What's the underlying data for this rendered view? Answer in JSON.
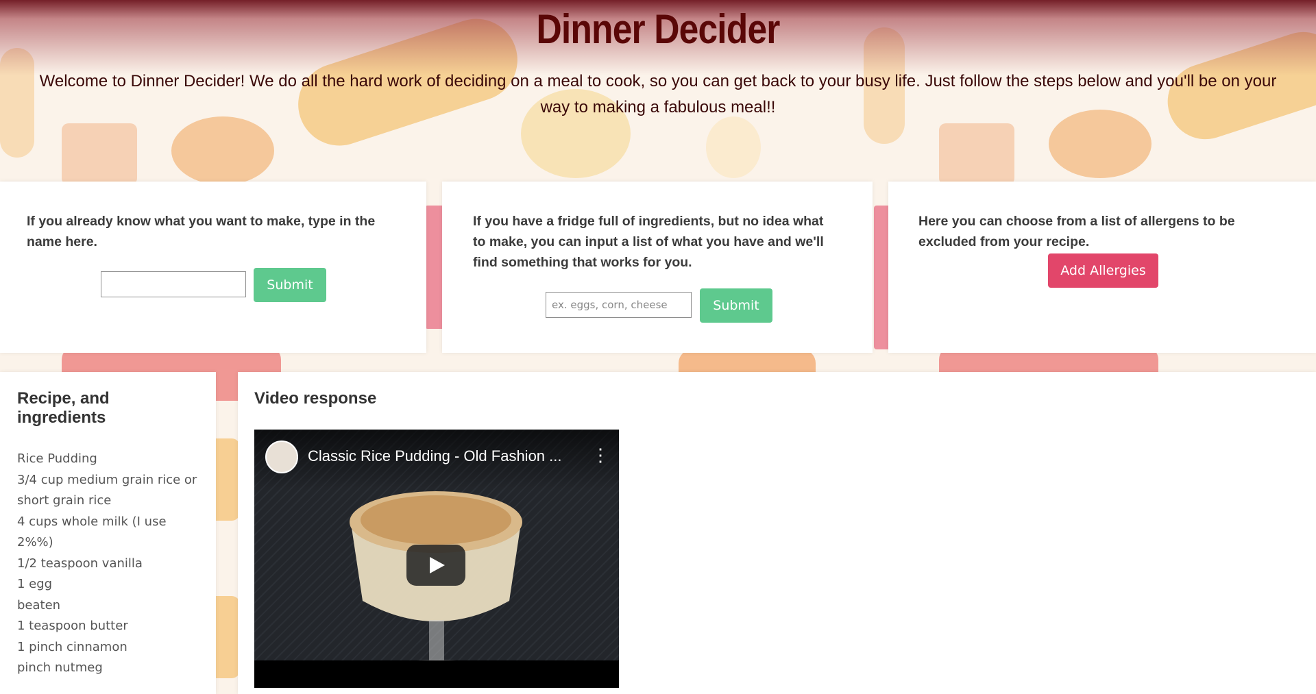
{
  "header": {
    "title": "Dinner Decider",
    "intro_line1": "Welcome to Dinner Decider! We do all the hard work of deciding on a meal to cook, so you can get back to your busy life. Just follow the steps below and you'll be on your",
    "intro_line2": "way to making a fabulous meal!!"
  },
  "card_name": {
    "text_line1": "If you already know what you want to make, type in the",
    "text_line2": "name here.",
    "input_value": "",
    "input_placeholder": "",
    "submit_label": "Submit"
  },
  "card_ingredients": {
    "text_line1": "If you have a fridge full of ingredients, but no idea what",
    "text_line2": "to make, you can input a list of what you have and we'll",
    "text_line3": "find something that works for you.",
    "input_value": "",
    "input_placeholder": "ex. eggs, corn, cheese",
    "submit_label": "Submit"
  },
  "card_allergens": {
    "text_line1": "Here you can choose from a list of allergens to be",
    "text_line2": "excluded from your recipe.",
    "button_label": "Add Allergies"
  },
  "recipe": {
    "title_line1": "Recipe, and",
    "title_line2": "ingredients",
    "lines": [
      "Rice Pudding",
      "3/4 cup medium grain rice or",
      "short grain rice",
      "4 cups whole milk (I use",
      "2%%)",
      "1/2 teaspoon vanilla",
      "1 egg",
      "beaten",
      "1 teaspoon butter",
      "1 pinch cinnamon",
      "pinch nutmeg"
    ]
  },
  "video_section": {
    "title": "Video response",
    "video_title": "Classic Rice Pudding - Old Fashion ...",
    "menu_glyph": "⋮"
  },
  "colors": {
    "title": "#5a0707",
    "submit_button": "#5ec98e",
    "allergies_button": "#e2466a"
  },
  "icons": [
    "play-icon",
    "more-vert-icon",
    "channel-avatar-icon"
  ]
}
